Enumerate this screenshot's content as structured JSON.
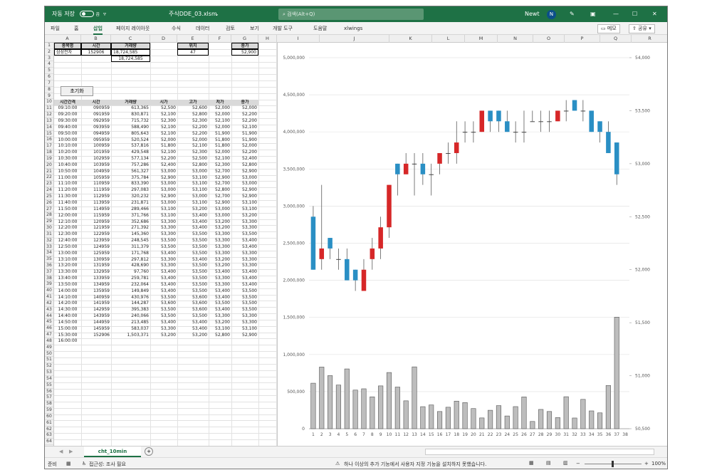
{
  "window": {
    "autosave_label": "자동 저장",
    "autosave_state": "끔",
    "filename": "주식DDE_03.xlsm",
    "search_placeholder": "검색(Alt+Q)",
    "user_name": "Newt",
    "user_initial": "N"
  },
  "ribbon": {
    "tabs": [
      "파일",
      "홈",
      "삽입",
      "페이지 레이아웃",
      "수식",
      "데이터",
      "검토",
      "보기",
      "개발 도구",
      "도움말",
      "xlwings"
    ],
    "active_tab": "삽입",
    "memo_button": "메모",
    "share_button": "공유"
  },
  "columns": [
    "A",
    "B",
    "C",
    "D",
    "E",
    "F",
    "G",
    "H",
    "I",
    "J",
    "K",
    "L",
    "M",
    "N",
    "O",
    "P",
    "Q",
    "R"
  ],
  "info": {
    "name_header": "종목명",
    "time_header": "시간",
    "volume_header": "거래량",
    "position_header": "위치",
    "close_header": "종가",
    "name": "삼성전자",
    "time": "152906",
    "volume": "18,724,585",
    "volume2": "18,724,585",
    "position": "47",
    "close": "52,900"
  },
  "reset_button": "초기화",
  "table": {
    "headers": [
      "시간간격",
      "시간",
      "거래량",
      "시가",
      "고가",
      "저가",
      "종가"
    ],
    "rows": [
      [
        "09:10:00",
        "090959",
        "613,365",
        "52,500",
        "52,600",
        "52,000",
        "52,000"
      ],
      [
        "09:20:00",
        "091959",
        "830,871",
        "52,100",
        "52,800",
        "52,000",
        "52,200"
      ],
      [
        "09:30:00",
        "092959",
        "715,732",
        "52,300",
        "52,300",
        "52,100",
        "52,200"
      ],
      [
        "09:40:00",
        "093959",
        "588,490",
        "52,100",
        "52,200",
        "52,000",
        "52,100"
      ],
      [
        "09:50:00",
        "094959",
        "805,643",
        "52,100",
        "52,200",
        "51,900",
        "51,900"
      ],
      [
        "10:00:00",
        "095959",
        "520,524",
        "52,000",
        "52,000",
        "51,800",
        "51,900"
      ],
      [
        "10:10:00",
        "100959",
        "537,816",
        "51,800",
        "52,100",
        "51,800",
        "52,000"
      ],
      [
        "10:20:00",
        "101959",
        "429,548",
        "52,100",
        "52,300",
        "52,000",
        "52,200"
      ],
      [
        "10:30:00",
        "102959",
        "577,134",
        "52,200",
        "52,500",
        "52,100",
        "52,400"
      ],
      [
        "10:40:00",
        "103959",
        "757,286",
        "52,400",
        "52,800",
        "52,300",
        "52,800"
      ],
      [
        "10:50:00",
        "104959",
        "561,327",
        "53,000",
        "53,000",
        "52,700",
        "52,900"
      ],
      [
        "11:00:00",
        "105959",
        "375,784",
        "52,900",
        "53,100",
        "52,900",
        "53,000"
      ],
      [
        "11:10:00",
        "110959",
        "833,390",
        "53,000",
        "53,100",
        "52,700",
        "53,000"
      ],
      [
        "11:20:00",
        "111959",
        "297,083",
        "53,000",
        "53,100",
        "52,800",
        "52,900"
      ],
      [
        "11:30:00",
        "112959",
        "320,232",
        "52,900",
        "53,000",
        "52,700",
        "52,900"
      ],
      [
        "11:40:00",
        "113959",
        "231,871",
        "53,000",
        "53,100",
        "52,900",
        "53,100"
      ],
      [
        "11:50:00",
        "114959",
        "289,466",
        "53,100",
        "53,200",
        "53,000",
        "53,100"
      ],
      [
        "12:00:00",
        "115959",
        "371,766",
        "53,100",
        "53,400",
        "53,000",
        "53,200"
      ],
      [
        "12:10:00",
        "120959",
        "352,686",
        "53,300",
        "53,400",
        "53,200",
        "53,300"
      ],
      [
        "12:20:00",
        "121959",
        "271,392",
        "53,300",
        "53,400",
        "53,200",
        "53,300"
      ],
      [
        "12:30:00",
        "122959",
        "145,360",
        "53,300",
        "53,500",
        "53,300",
        "53,500"
      ],
      [
        "12:40:00",
        "123959",
        "248,545",
        "53,500",
        "53,500",
        "53,300",
        "53,400"
      ],
      [
        "12:50:00",
        "124959",
        "311,379",
        "53,500",
        "53,500",
        "53,300",
        "53,400"
      ],
      [
        "13:00:00",
        "125959",
        "171,768",
        "53,400",
        "53,500",
        "53,300",
        "53,300"
      ],
      [
        "13:10:00",
        "130959",
        "297,812",
        "53,300",
        "53,400",
        "53,200",
        "53,300"
      ],
      [
        "13:20:00",
        "131959",
        "428,690",
        "53,300",
        "53,500",
        "53,200",
        "53,300"
      ],
      [
        "13:30:00",
        "132959",
        "97,760",
        "53,400",
        "53,500",
        "53,400",
        "53,400"
      ],
      [
        "13:40:00",
        "133959",
        "259,781",
        "53,400",
        "53,500",
        "53,300",
        "53,400"
      ],
      [
        "13:50:00",
        "134959",
        "232,064",
        "53,400",
        "53,500",
        "53,300",
        "53,400"
      ],
      [
        "14:00:00",
        "135959",
        "149,849",
        "53,400",
        "53,500",
        "53,400",
        "53,500"
      ],
      [
        "14:10:00",
        "140959",
        "430,976",
        "53,500",
        "53,600",
        "53,400",
        "53,500"
      ],
      [
        "14:20:00",
        "141959",
        "144,287",
        "53,600",
        "53,600",
        "53,500",
        "53,500"
      ],
      [
        "14:30:00",
        "142959",
        "395,383",
        "53,500",
        "53,600",
        "53,400",
        "53,500"
      ],
      [
        "14:40:00",
        "143959",
        "240,066",
        "53,500",
        "53,500",
        "53,300",
        "53,300"
      ],
      [
        "14:50:00",
        "144959",
        "213,485",
        "53,400",
        "53,400",
        "53,200",
        "53,300"
      ],
      [
        "15:00:00",
        "145959",
        "583,037",
        "53,300",
        "53,400",
        "53,100",
        "53,100"
      ],
      [
        "15:30:00",
        "152906",
        "1,503,371",
        "53,200",
        "53,200",
        "52,800",
        "52,900"
      ],
      [
        "16:00:00",
        "",
        "",
        "",
        "",
        "",
        ""
      ]
    ]
  },
  "chart_data": {
    "type": "candlestick_volume",
    "categories": [
      "1",
      "2",
      "3",
      "4",
      "5",
      "6",
      "7",
      "8",
      "9",
      "10",
      "11",
      "12",
      "13",
      "14",
      "15",
      "16",
      "17",
      "18",
      "19",
      "20",
      "21",
      "22",
      "23",
      "24",
      "25",
      "26",
      "27",
      "28",
      "29",
      "30",
      "31",
      "32",
      "33",
      "34",
      "35",
      "36",
      "37",
      "38"
    ],
    "open": [
      52500,
      52100,
      52300,
      52100,
      52100,
      52000,
      51800,
      52100,
      52200,
      52400,
      53000,
      52900,
      53000,
      53000,
      52900,
      53000,
      53100,
      53100,
      53300,
      53300,
      53300,
      53500,
      53500,
      53400,
      53300,
      53300,
      53400,
      53400,
      53400,
      53400,
      53500,
      53600,
      53500,
      53500,
      53400,
      53300,
      53200
    ],
    "high": [
      52600,
      52800,
      52300,
      52200,
      52200,
      52000,
      52100,
      52300,
      52500,
      52800,
      53000,
      53100,
      53100,
      53100,
      53000,
      53100,
      53200,
      53400,
      53400,
      53400,
      53500,
      53500,
      53500,
      53500,
      53400,
      53500,
      53500,
      53500,
      53500,
      53500,
      53600,
      53600,
      53600,
      53500,
      53400,
      53400,
      53200
    ],
    "low": [
      52000,
      52000,
      52100,
      52000,
      51900,
      51800,
      51800,
      52000,
      52100,
      52300,
      52700,
      52900,
      52700,
      52800,
      52700,
      52900,
      53000,
      53000,
      53200,
      53200,
      53300,
      53300,
      53300,
      53300,
      53200,
      53200,
      53400,
      53300,
      53300,
      53400,
      53400,
      53500,
      53400,
      53300,
      53200,
      53100,
      52800
    ],
    "close": [
      52000,
      52200,
      52200,
      52100,
      51900,
      51900,
      52000,
      52200,
      52400,
      52800,
      52900,
      53000,
      53000,
      52900,
      52900,
      53100,
      53100,
      53200,
      53300,
      53300,
      53500,
      53400,
      53400,
      53300,
      53300,
      53300,
      53400,
      53400,
      53400,
      53500,
      53500,
      53500,
      53500,
      53300,
      53300,
      53100,
      52900
    ],
    "volume": [
      613365,
      830871,
      715732,
      588490,
      805643,
      520524,
      537816,
      429548,
      577134,
      757286,
      561327,
      375784,
      833390,
      297083,
      320232,
      231871,
      289466,
      371766,
      352686,
      271392,
      145360,
      248545,
      311379,
      171768,
      297812,
      428690,
      97760,
      259781,
      232064,
      149849,
      430976,
      144287,
      395383,
      240066,
      213485,
      583037,
      1503371
    ],
    "left_axis_ticks": [
      "0",
      "500,000",
      "1,000,000",
      "1,500,000",
      "2,000,000",
      "2,500,000",
      "3,000,000",
      "3,500,000",
      "4,000,000",
      "4,500,000",
      "5,000,000"
    ],
    "right_axis_ticks": [
      "50,500",
      "51,000",
      "51,500",
      "52,000",
      "52,500",
      "53,000",
      "53,500",
      "54,000"
    ],
    "left_range": [
      0,
      5000000
    ],
    "right_range": [
      50500,
      54000
    ],
    "up_color": "#d62728",
    "down_color": "#2a8fc4",
    "volume_color": "#bdbdbd",
    "grid": "horizontal"
  },
  "sheet_tab": "cht_10min",
  "status": {
    "ready": "준비",
    "accessibility": "접근성: 조사 필요",
    "message": "하나 이상의 추가 기능에서 사용자 지정 기능을 설치하지 못했습니다.",
    "zoom": "100%"
  }
}
